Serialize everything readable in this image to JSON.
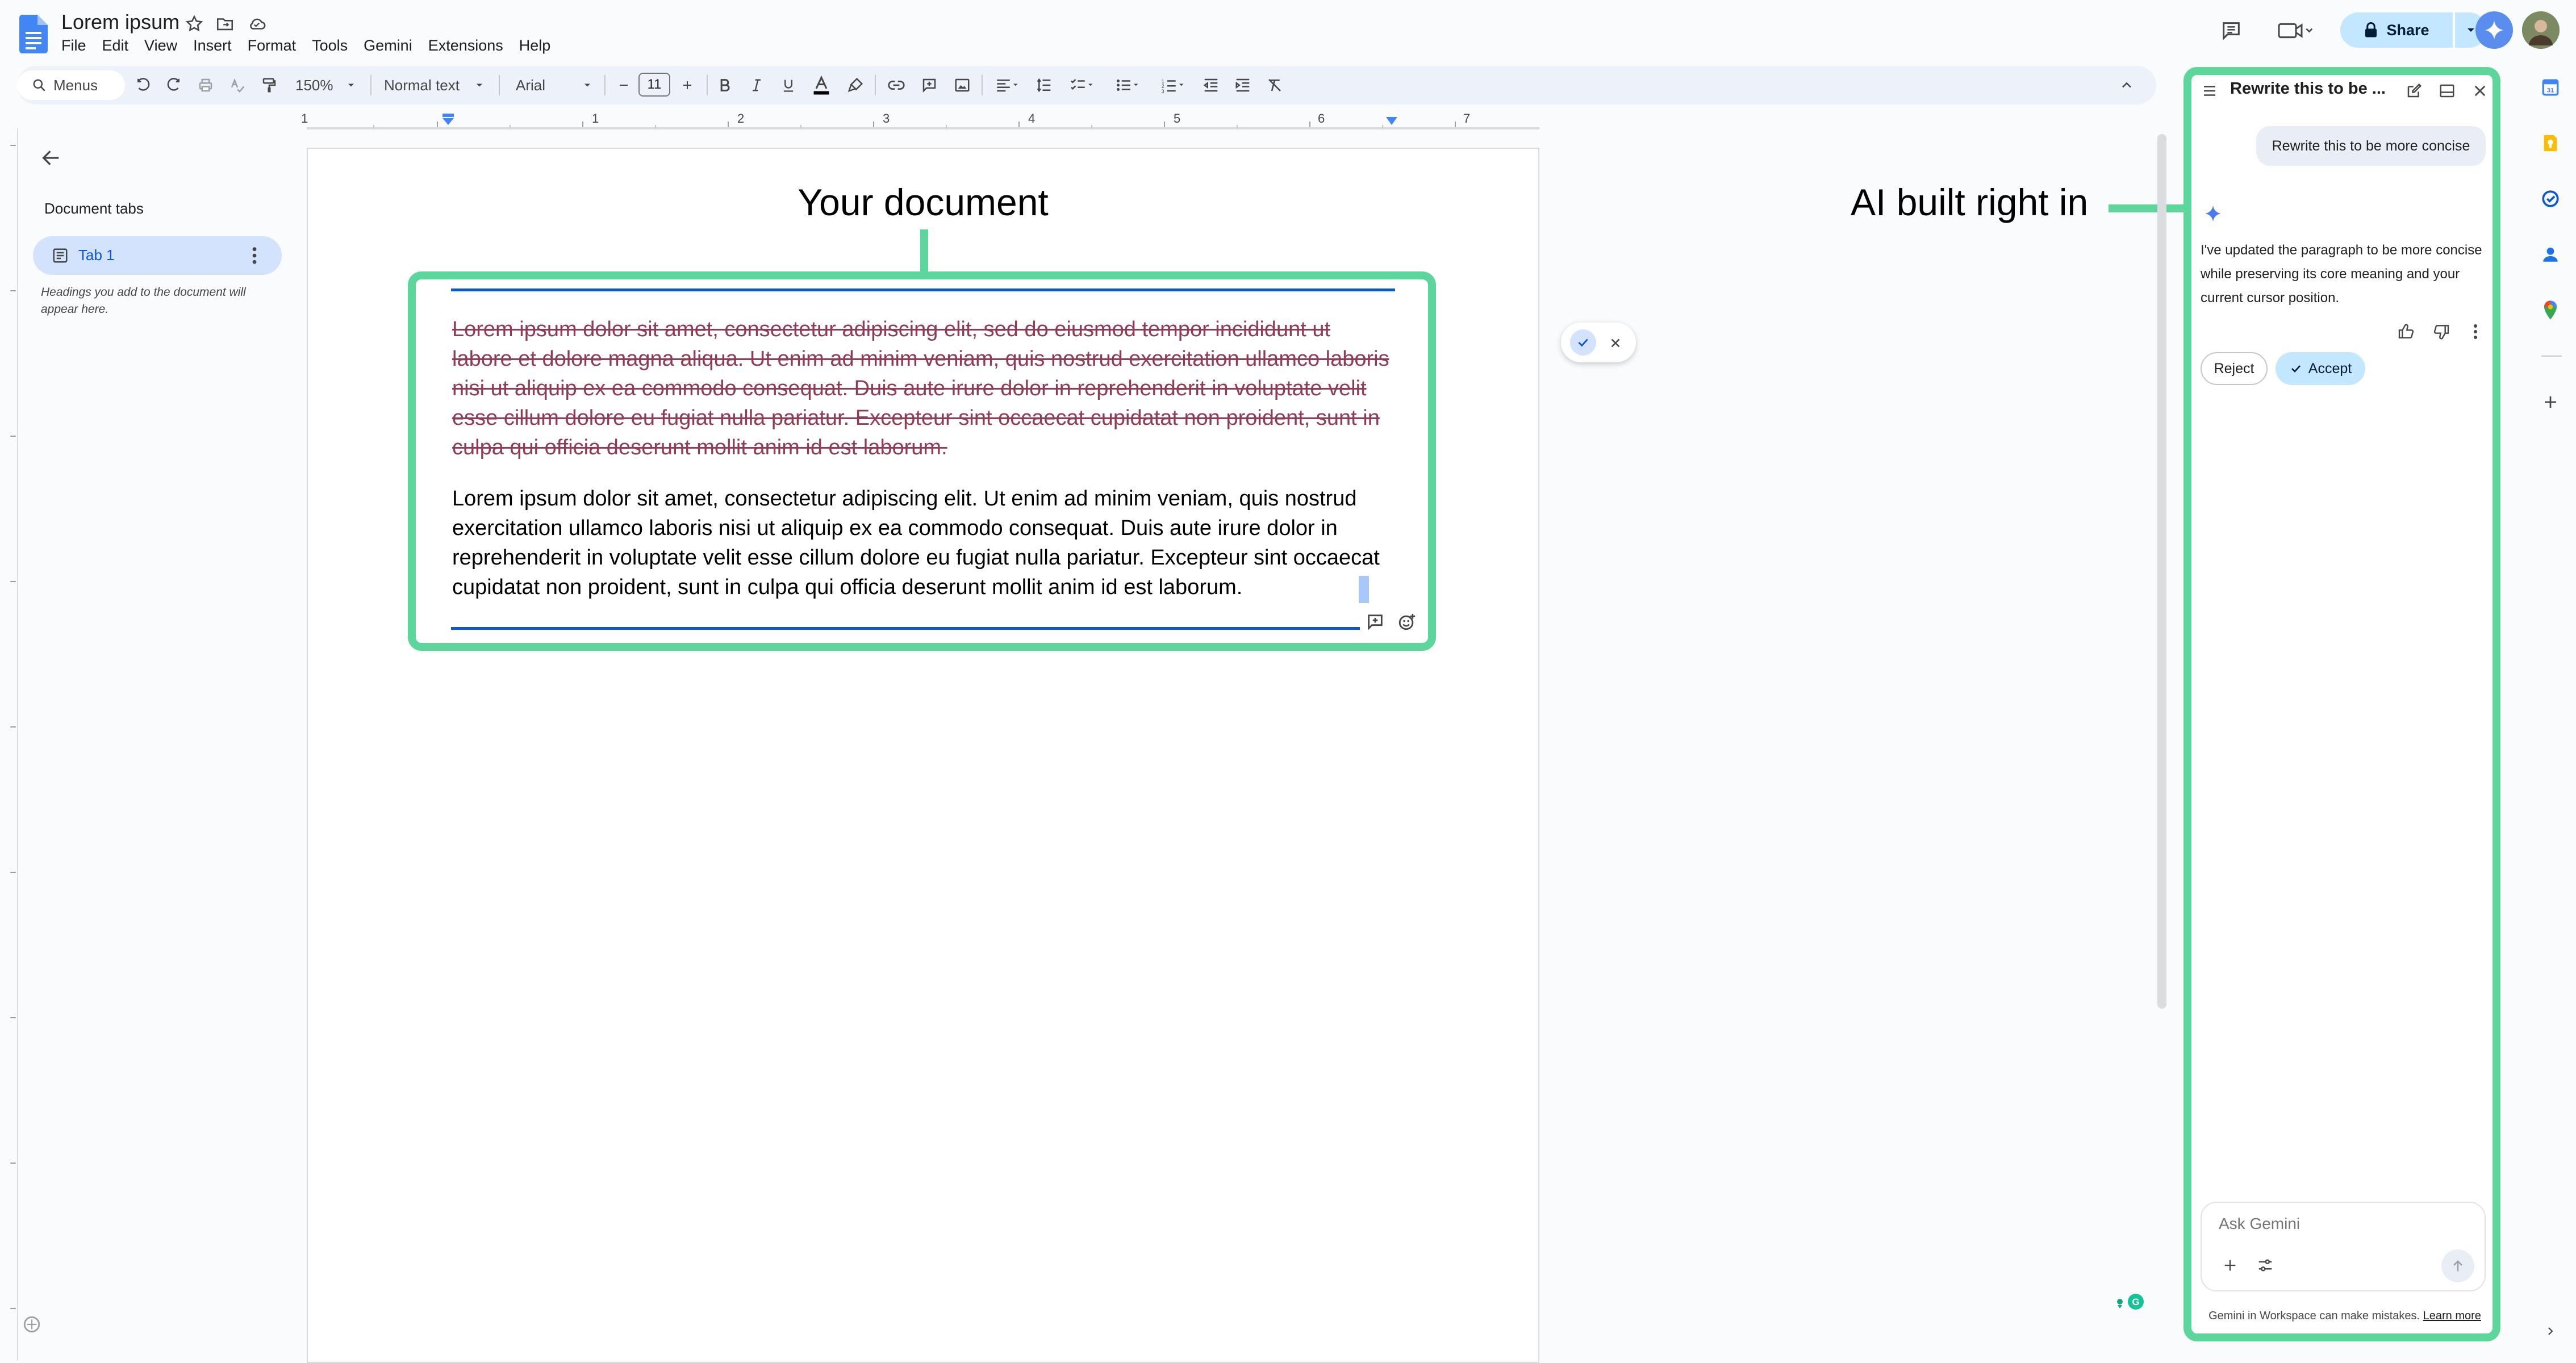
{
  "doc": {
    "title": "Lorem ipsum"
  },
  "menubar": [
    "File",
    "Edit",
    "View",
    "Insert",
    "Format",
    "Tools",
    "Gemini",
    "Extensions",
    "Help"
  ],
  "header": {
    "share_label": "Share"
  },
  "toolbar": {
    "menus_label": "Menus",
    "zoom": "150%",
    "style": "Normal text",
    "font": "Arial",
    "font_size": "11"
  },
  "ruler": {
    "numbers": [
      "1",
      "1",
      "2",
      "3",
      "4",
      "5",
      "6",
      "7"
    ]
  },
  "tabs_panel": {
    "title": "Document tabs",
    "tab_label": "Tab 1",
    "hint": "Headings you add to the document will appear here."
  },
  "annotations": {
    "document": "Your document",
    "ai": "AI built right in"
  },
  "document": {
    "old_paragraph": "Lorem ipsum dolor sit amet, consectetur adipiscing elit, sed do eiusmod tempor incididunt ut labore et dolore magna aliqua. Ut enim ad minim veniam, quis nostrud exercitation ullamco laboris nisi ut aliquip ex ea commodo consequat. Duis aute irure dolor in reprehenderit in voluptate velit esse cillum dolore eu fugiat nulla pariatur. Excepteur sint occaecat cupidatat non proident, sunt in culpa qui officia deserunt mollit anim id est laborum.",
    "new_paragraph": "Lorem ipsum dolor sit amet, consectetur adipiscing elit. Ut enim ad minim veniam, quis nostrud exercitation ullamco laboris nisi ut aliquip ex ea commodo consequat. Duis aute irure dolor in reprehenderit in voluptate velit esse cillum dolore eu fugiat nulla pariatur. Excepteur sint occaecat cupidatat non proident, sunt in culpa qui officia deserunt mollit anim id est laborum."
  },
  "gemini_panel": {
    "title": "Rewrite this to be ...",
    "user_message": "Rewrite this to be more concise",
    "response": "I've updated the paragraph to be more concise while preserving its core meaning and your current cursor position.",
    "reject_label": "Reject",
    "accept_label": "Accept",
    "ask_placeholder": "Ask Gemini",
    "disclaimer": "Gemini in Workspace can make mistakes.",
    "learn_more": "Learn more"
  },
  "colors": {
    "annotation_green": "#5cd69a",
    "accent_blue": "#0b57d0",
    "share_bg": "#c2e7ff",
    "deleted_text": "#8e3d55"
  },
  "icons": [
    "docs-logo-icon",
    "star-icon",
    "move-folder-icon",
    "cloud-status-icon",
    "comment-history-icon",
    "meet-icon",
    "lock-icon",
    "gemini-spark-icon",
    "undo-icon",
    "redo-icon",
    "print-icon",
    "spellcheck-icon",
    "paint-format-icon",
    "bold-icon",
    "italic-icon",
    "underline-icon",
    "text-color-icon",
    "highlight-icon",
    "link-icon",
    "add-comment-icon",
    "image-icon",
    "align-icon",
    "line-spacing-icon",
    "checklist-icon",
    "bullet-list-icon",
    "numbered-list-icon",
    "indent-decrease-icon",
    "indent-increase-icon",
    "clear-format-icon",
    "collapse-icon",
    "back-arrow-icon",
    "calendar-icon",
    "keep-icon",
    "tasks-icon",
    "contacts-icon",
    "maps-icon",
    "add-icon"
  ]
}
